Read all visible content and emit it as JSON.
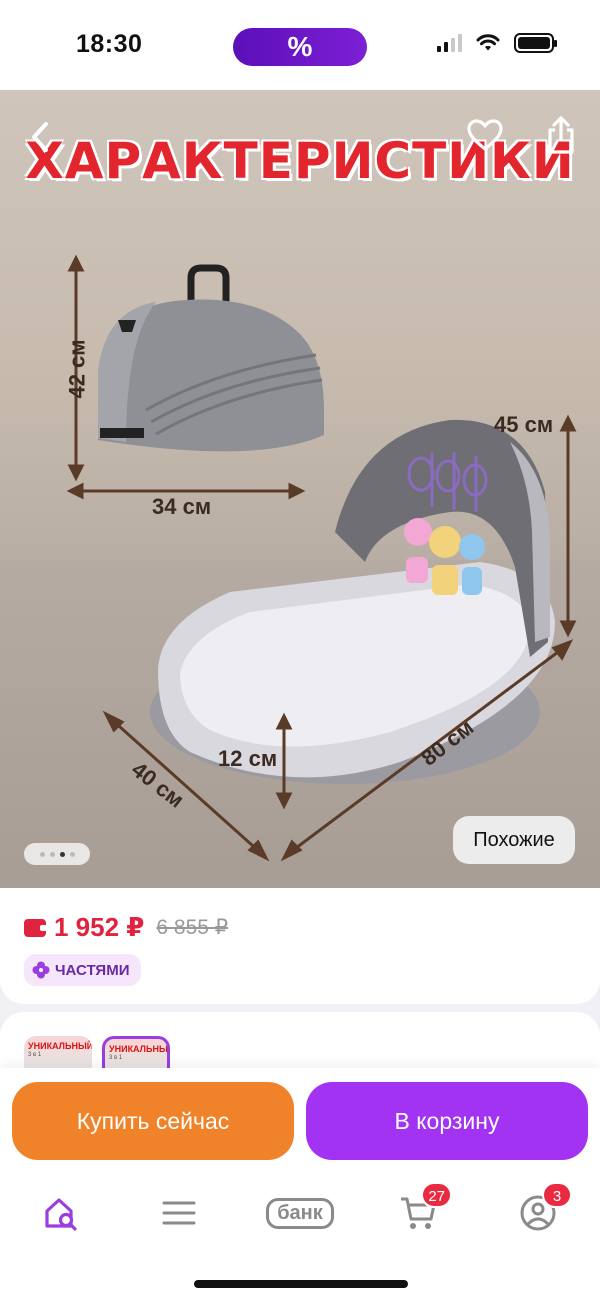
{
  "status_bar": {
    "time": "18:30",
    "center_pill": "%",
    "icons": [
      "signal-icon",
      "wifi-icon",
      "battery-icon"
    ]
  },
  "product_image": {
    "title": "ХАРАКТЕРИСТИКИ",
    "dimensions": {
      "bag_height": "42 см",
      "bag_width": "34 см",
      "crib_height": "45 см",
      "crib_side": "12 см",
      "crib_width": "40 см",
      "crib_length": "80 см"
    },
    "similar_label": "Похожие",
    "carousel": {
      "total": 4,
      "active": 3
    },
    "icons": [
      "back-icon",
      "heart-icon",
      "share-icon"
    ]
  },
  "price": {
    "current": "1 952 ₽",
    "old": "6 855 ₽",
    "installments_label": "ЧАСТЯМИ"
  },
  "variants": [
    {
      "title": "УНИКАЛЬНЫЙ",
      "badge": "3 в 1",
      "selected": false
    },
    {
      "title": "УНИКАЛЬНЫЙ",
      "badge": "3 в 1",
      "selected": true
    }
  ],
  "actions": {
    "buy_now": "Купить сейчас",
    "add_to_cart": "В корзину"
  },
  "tab_bar": {
    "bank_label": "банк",
    "cart_badge": "27",
    "profile_badge": "3"
  },
  "colors": {
    "accent_purple": "#a233f2",
    "buy_orange": "#f0832a",
    "price_red": "#e0233e",
    "title_red": "#e3262e"
  }
}
